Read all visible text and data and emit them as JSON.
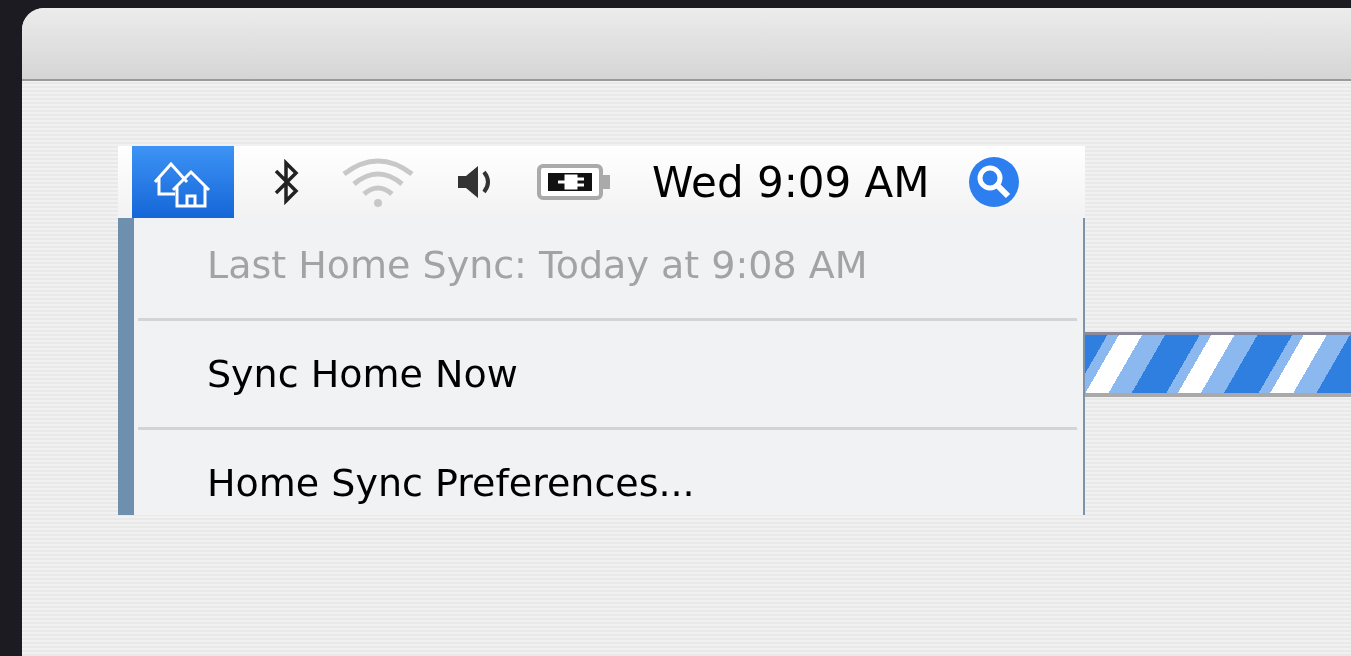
{
  "progress": {
    "indeterminate": true
  },
  "menu_bar": {
    "extras": [
      {
        "kind": "home",
        "selected": true
      },
      {
        "kind": "bluetooth",
        "selected": false
      },
      {
        "kind": "wifi",
        "selected": false
      },
      {
        "kind": "volume",
        "selected": false
      },
      {
        "kind": "battery",
        "selected": false
      },
      {
        "kind": "clock",
        "text": "Wed 9:09 AM",
        "selected": false
      },
      {
        "kind": "spotlight",
        "selected": false
      }
    ]
  },
  "menu": {
    "items": [
      {
        "kind": "item",
        "label": "Last Home Sync: Today at 9:08 AM",
        "disabled": true
      },
      {
        "kind": "separator"
      },
      {
        "kind": "item",
        "label": "Sync Home Now",
        "disabled": false
      },
      {
        "kind": "separator"
      },
      {
        "kind": "item",
        "label": "Home Sync Preferences...",
        "disabled": false
      }
    ]
  }
}
